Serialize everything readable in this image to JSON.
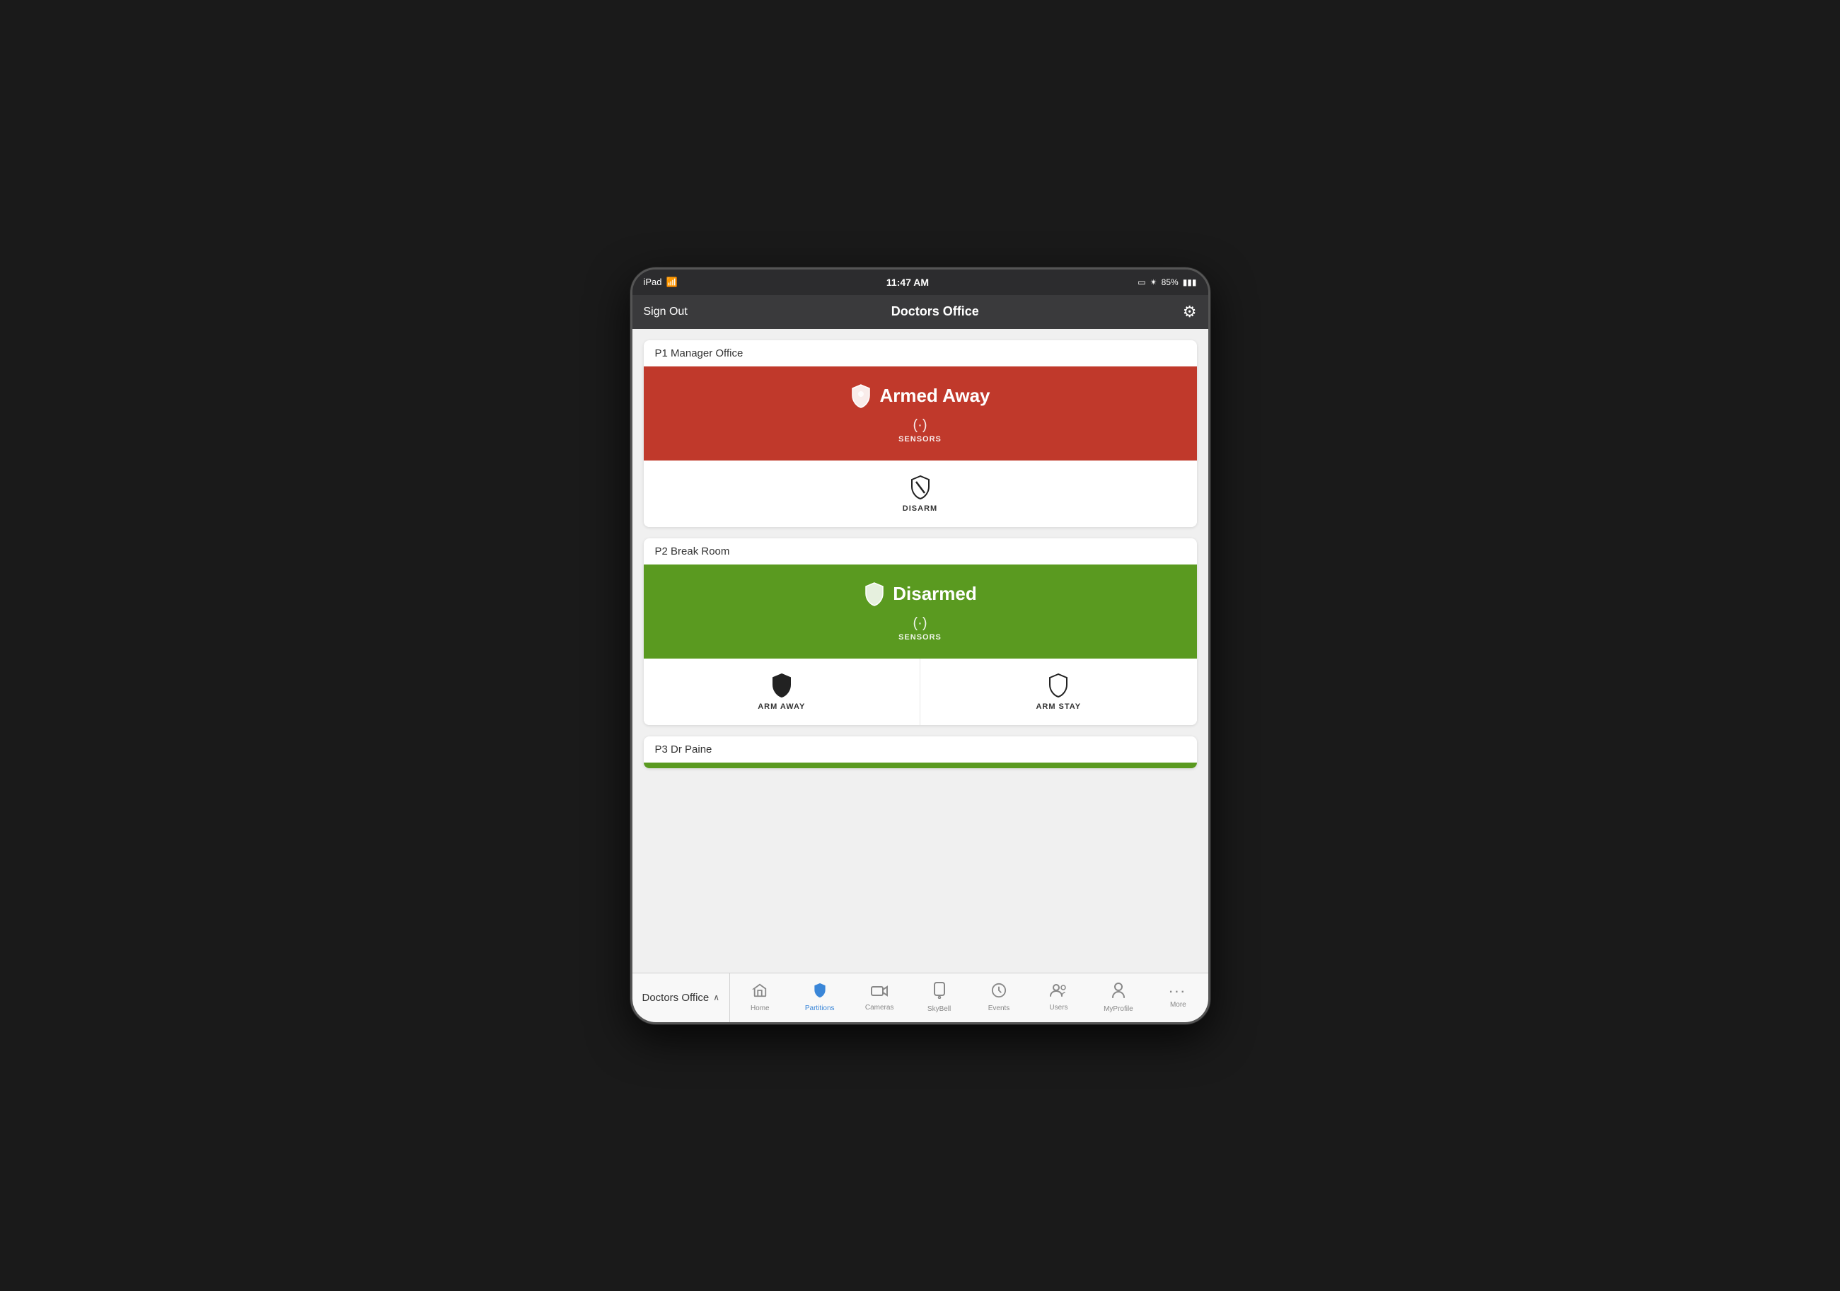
{
  "device": {
    "status_bar": {
      "carrier": "iPad",
      "wifi": "📶",
      "time": "11:47 AM",
      "screen_icon": "▭",
      "bluetooth": "✴",
      "battery_pct": "85%",
      "battery_block": "▮"
    }
  },
  "header": {
    "sign_out_label": "Sign Out",
    "title": "Doctors Office",
    "gear_icon": "⚙"
  },
  "partitions": [
    {
      "id": "p1",
      "label": "P1 Manager Office",
      "status": "armed",
      "status_text": "Armed Away",
      "sensors_label": "SENSORS",
      "actions": [
        {
          "id": "disarm",
          "label": "DISARM",
          "shield_type": "disarm"
        }
      ]
    },
    {
      "id": "p2",
      "label": "P2 Break Room",
      "status": "disarmed",
      "status_text": "Disarmed",
      "sensors_label": "SENSORS",
      "actions": [
        {
          "id": "arm_away",
          "label": "ARM AWAY",
          "shield_type": "arm_away"
        },
        {
          "id": "arm_stay",
          "label": "ARM STAY",
          "shield_type": "arm_stay"
        }
      ]
    },
    {
      "id": "p3",
      "label": "P3 Dr Paine",
      "status": "partial",
      "status_text": "",
      "sensors_label": "",
      "actions": []
    }
  ],
  "tab_bar": {
    "location": "Doctors Office",
    "chevron": "∧",
    "tabs": [
      {
        "id": "home",
        "label": "Home",
        "icon": "⌂",
        "active": false
      },
      {
        "id": "partitions",
        "label": "Partitions",
        "icon": "🛡",
        "active": true
      },
      {
        "id": "cameras",
        "label": "Cameras",
        "icon": "📹",
        "active": false
      },
      {
        "id": "skybell",
        "label": "SkyBell",
        "icon": "📱",
        "active": false
      },
      {
        "id": "events",
        "label": "Events",
        "icon": "🕐",
        "active": false
      },
      {
        "id": "users",
        "label": "Users",
        "icon": "👥",
        "active": false
      },
      {
        "id": "myprofile",
        "label": "MyProfile",
        "icon": "👤",
        "active": false
      },
      {
        "id": "more",
        "label": "More",
        "icon": "···",
        "active": false
      }
    ]
  },
  "colors": {
    "armed_bg": "#c0392b",
    "disarmed_bg": "#5a9a20",
    "active_tab": "#3a86d8"
  }
}
